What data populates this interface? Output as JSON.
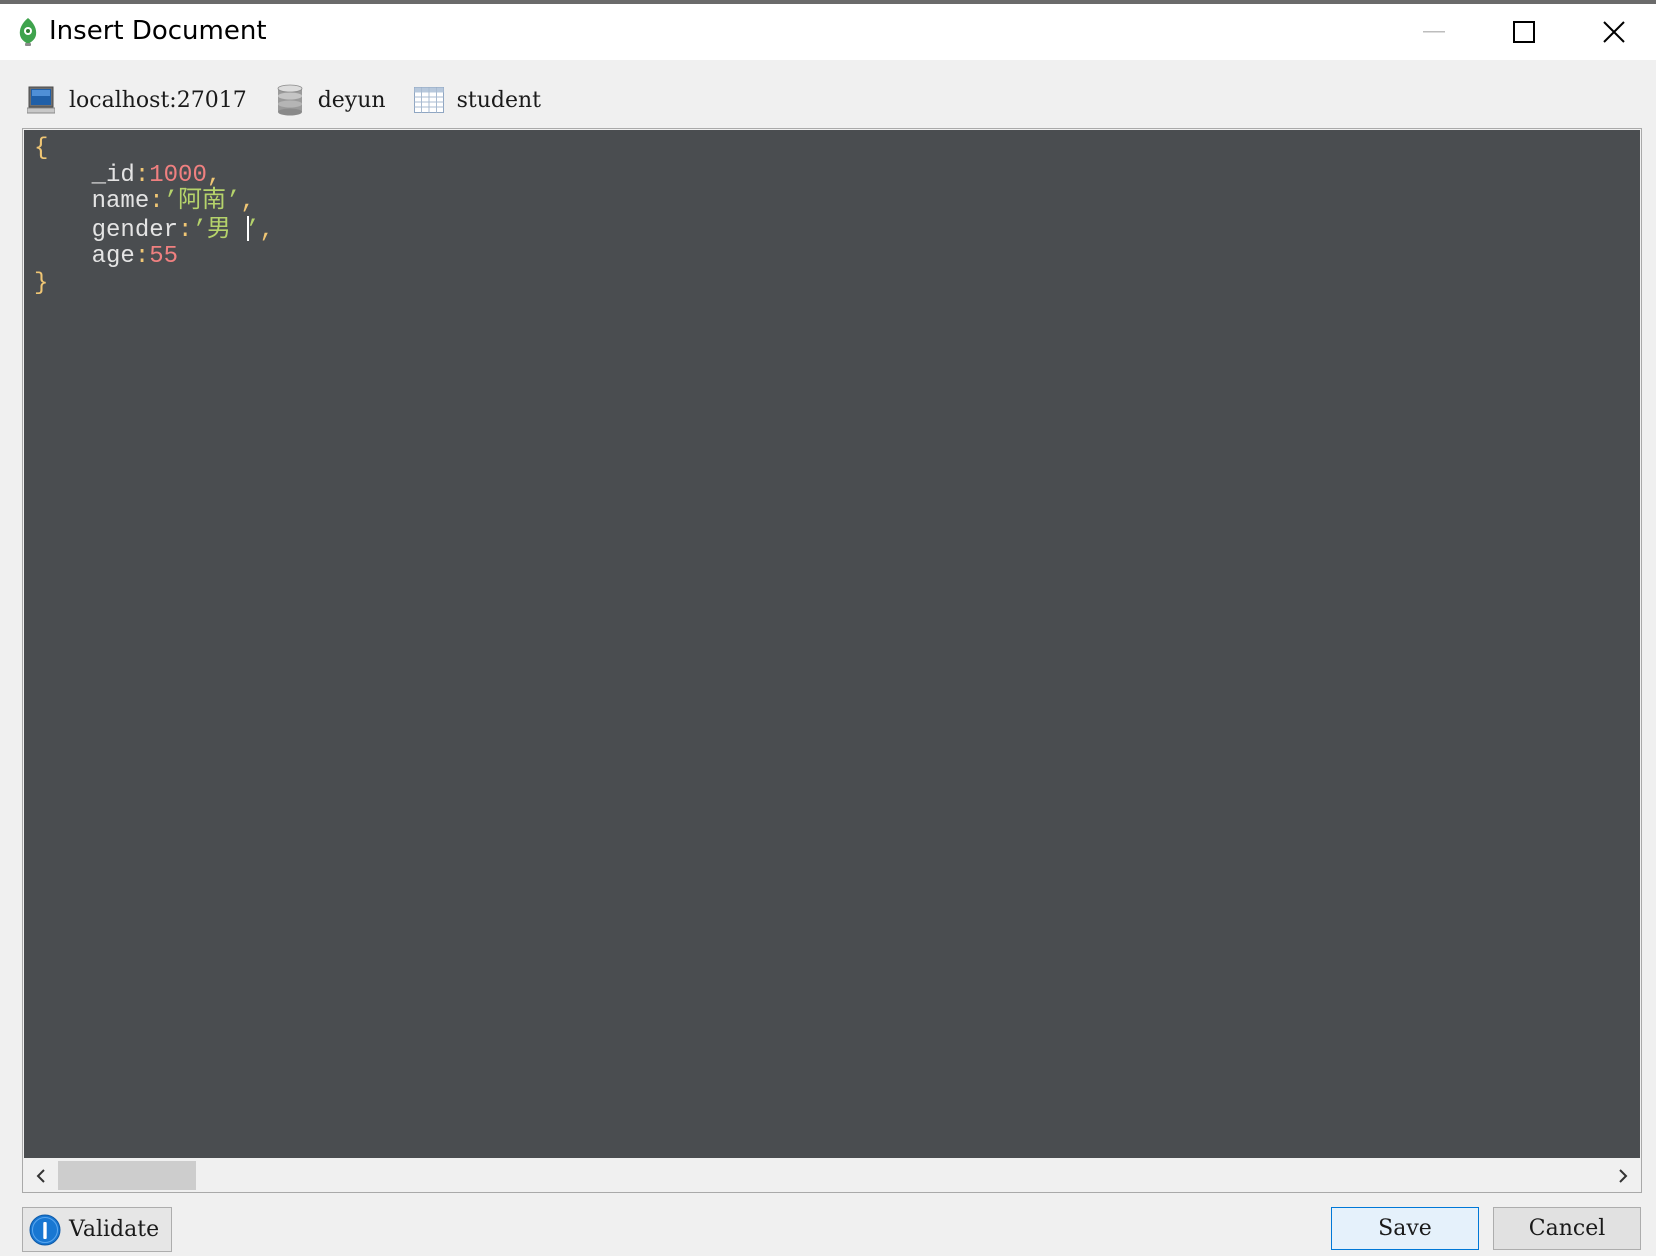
{
  "window": {
    "title": "Insert Document"
  },
  "breadcrumb": {
    "server": "localhost:27017",
    "database": "deyun",
    "collection": "student",
    "icons": [
      "server-icon",
      "database-icon",
      "collection-icon"
    ]
  },
  "editor": {
    "open_brace": "{",
    "close_brace": "}",
    "fields": [
      {
        "key": "_id",
        "sep": ":",
        "value": "1000",
        "suffix": ","
      },
      {
        "key": "name",
        "sep": ":",
        "value": "’阿南’",
        "suffix": ","
      },
      {
        "key": "gender",
        "sep": ":",
        "value_before_cursor": "’男 ",
        "value_after_cursor": "’",
        "suffix": ","
      },
      {
        "key": "age",
        "sep": ":",
        "value": "55",
        "suffix": ""
      }
    ]
  },
  "footer": {
    "validate_label": "Validate",
    "save_label": "Save",
    "cancel_label": "Cancel"
  },
  "colors": {
    "editor_background": "#4a4d50",
    "punctuation": "#f0c674",
    "number": "#f08080",
    "string": "#b5d36b",
    "accent": "#0078d7"
  }
}
